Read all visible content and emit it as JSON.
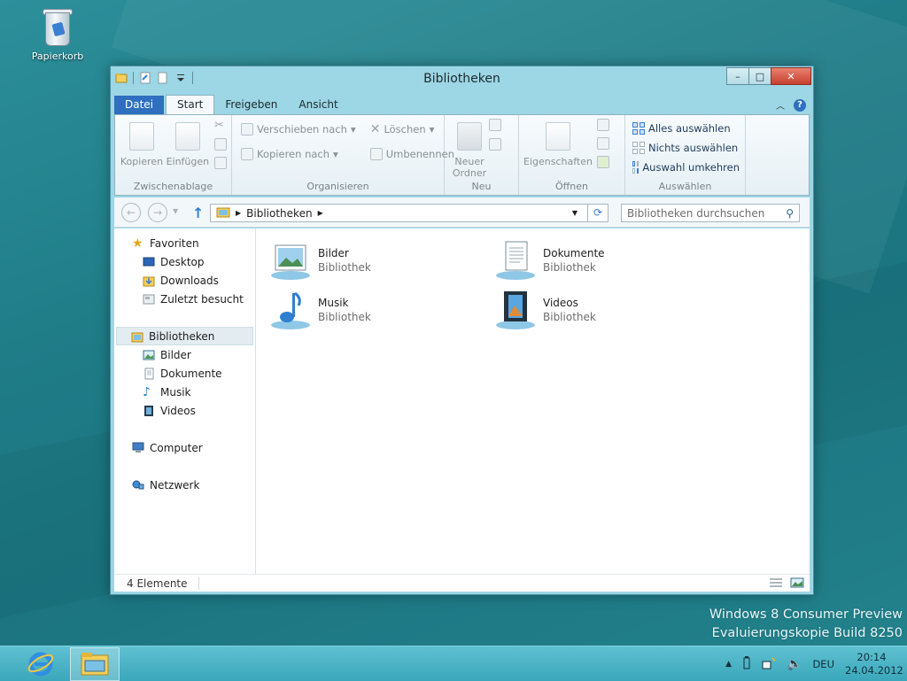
{
  "desktop": {
    "recycle_bin_label": "Papierkorb",
    "watermark_line1": "Windows 8 Consumer Preview",
    "watermark_line2": "Evaluierungskopie Build 8250"
  },
  "window": {
    "title": "Bibliotheken",
    "minimize": "–",
    "maximize": "□",
    "close": "✕"
  },
  "ribbon": {
    "tabs": [
      "Datei",
      "Start",
      "Freigeben",
      "Ansicht"
    ],
    "groups": {
      "clipboard": {
        "label": "Zwischenablage",
        "copy": "Kopieren",
        "paste": "Einfügen"
      },
      "organize": {
        "label": "Organisieren",
        "move_to": "Verschieben nach",
        "copy_to": "Kopieren nach",
        "delete": "Löschen",
        "rename": "Umbenennen"
      },
      "new": {
        "label": "Neu",
        "new_folder": "Neuer Ordner"
      },
      "open": {
        "label": "Öffnen",
        "properties": "Eigenschaften"
      },
      "select": {
        "label": "Auswählen",
        "select_all": "Alles auswählen",
        "select_none": "Nichts auswählen",
        "invert": "Auswahl umkehren"
      }
    }
  },
  "navigation": {
    "address": "Bibliotheken",
    "search_placeholder": "Bibliotheken durchsuchen"
  },
  "navpane": {
    "favorites": {
      "label": "Favoriten",
      "items": [
        "Desktop",
        "Downloads",
        "Zuletzt besucht"
      ]
    },
    "libraries": {
      "label": "Bibliotheken",
      "items": [
        "Bilder",
        "Dokumente",
        "Musik",
        "Videos"
      ]
    },
    "computer": "Computer",
    "network": "Netzwerk"
  },
  "files": [
    {
      "name": "Bilder",
      "type": "Bibliothek",
      "icon": "pictures-library-icon"
    },
    {
      "name": "Dokumente",
      "type": "Bibliothek",
      "icon": "documents-library-icon"
    },
    {
      "name": "Musik",
      "type": "Bibliothek",
      "icon": "music-library-icon"
    },
    {
      "name": "Videos",
      "type": "Bibliothek",
      "icon": "videos-library-icon"
    }
  ],
  "status": {
    "count": "4 Elemente"
  },
  "taskbar": {
    "language": "DEU",
    "time": "20:14",
    "date": "24.04.2012"
  },
  "colors": {
    "accent": "#2e6fbf",
    "window_frame": "#9dd6e4",
    "desktop": "#1f7d88",
    "close_button": "#c7402e"
  }
}
